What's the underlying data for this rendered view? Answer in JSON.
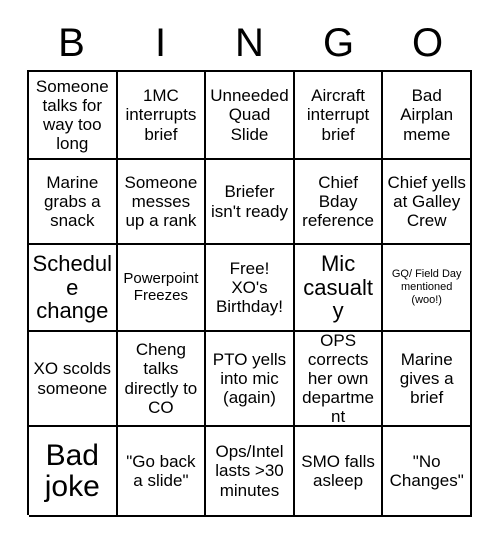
{
  "card": {
    "title_letters": [
      "B",
      "I",
      "N",
      "G",
      "O"
    ],
    "rows": [
      [
        {
          "text": "Someone talks for way too long",
          "size": "sz-md"
        },
        {
          "text": "1MC interrupts brief",
          "size": "sz-md"
        },
        {
          "text": "Unneeded Quad Slide",
          "size": "sz-md"
        },
        {
          "text": "Aircraft interrupt brief",
          "size": "sz-md"
        },
        {
          "text": "Bad Airplan meme",
          "size": "sz-md"
        }
      ],
      [
        {
          "text": "Marine grabs a snack",
          "size": "sz-md"
        },
        {
          "text": "Someone messes up a rank",
          "size": "sz-md"
        },
        {
          "text": "Briefer isn't ready",
          "size": "sz-md"
        },
        {
          "text": "Chief Bday reference",
          "size": "sz-md"
        },
        {
          "text": "Chief yells at Galley Crew",
          "size": "sz-md"
        }
      ],
      [
        {
          "text": "Schedule change",
          "size": "sz-lg"
        },
        {
          "text": "Powerpoint Freezes",
          "size": "sz-sm"
        },
        {
          "text": "Free! XO's Birthday!",
          "size": "sz-md"
        },
        {
          "text": "Mic casualty",
          "size": "sz-lg"
        },
        {
          "text": "GQ/ Field Day mentioned (woo!)",
          "size": "sz-xs"
        }
      ],
      [
        {
          "text": "XO scolds someone",
          "size": "sz-md"
        },
        {
          "text": "Cheng talks directly to CO",
          "size": "sz-md"
        },
        {
          "text": "PTO yells into mic (again)",
          "size": "sz-md"
        },
        {
          "text": "OPS corrects her own department",
          "size": "sz-md"
        },
        {
          "text": "Marine gives a brief",
          "size": "sz-md"
        }
      ],
      [
        {
          "text": "Bad joke",
          "size": "sz-xl"
        },
        {
          "text": "\"Go back a slide\"",
          "size": "sz-md"
        },
        {
          "text": "Ops/Intel lasts >30 minutes",
          "size": "sz-md"
        },
        {
          "text": "SMO falls asleep",
          "size": "sz-md"
        },
        {
          "text": "\"No Changes\"",
          "size": "sz-md"
        }
      ]
    ],
    "colors": {
      "background": "#ffffff",
      "text": "#000000",
      "grid_line": "#000000"
    }
  }
}
